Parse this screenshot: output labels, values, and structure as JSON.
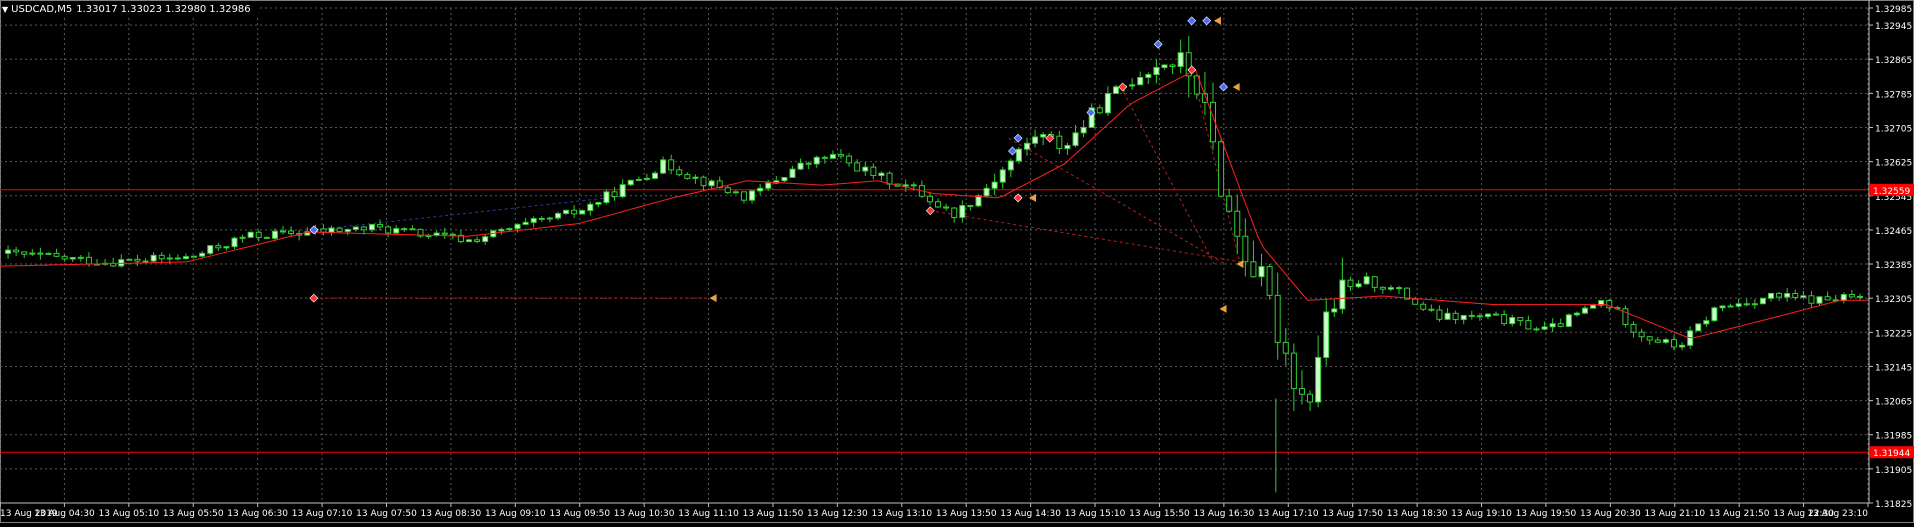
{
  "chart_data": {
    "type": "candlestick",
    "symbol": "USDCAD,M5",
    "header_values": {
      "open": "1.33017",
      "high": "1.33023",
      "low": "1.32980",
      "close": "1.32986"
    },
    "ylim": [
      1.31825,
      1.32985
    ],
    "y_ticks": [
      "1.32985",
      "1.32945",
      "1.32865",
      "1.32785",
      "1.32705",
      "1.32625",
      "1.32545",
      "1.32465",
      "1.32385",
      "1.32305",
      "1.32225",
      "1.32145",
      "1.32065",
      "1.31985",
      "1.31905",
      "1.31825"
    ],
    "x_ticks": [
      "13 Aug 2019",
      "13 Aug 04:30",
      "13 Aug 05:10",
      "13 Aug 05:50",
      "13 Aug 06:30",
      "13 Aug 07:10",
      "13 Aug 07:50",
      "13 Aug 08:30",
      "13 Aug 09:10",
      "13 Aug 09:50",
      "13 Aug 10:30",
      "13 Aug 11:10",
      "13 Aug 11:50",
      "13 Aug 12:30",
      "13 Aug 13:10",
      "13 Aug 13:50",
      "13 Aug 14:30",
      "13 Aug 15:10",
      "13 Aug 15:50",
      "13 Aug 16:30",
      "13 Aug 17:10",
      "13 Aug 17:50",
      "13 Aug 18:30",
      "13 Aug 19:10",
      "13 Aug 19:50",
      "13 Aug 20:30",
      "13 Aug 21:10",
      "13 Aug 21:50",
      "13 Aug 22:30",
      "13 Aug 23:10"
    ],
    "horizontal_lines": [
      {
        "price": 1.32559,
        "label": "1.32559",
        "color": "#ff0000"
      },
      {
        "price": 1.31944,
        "label": "1.31944",
        "color": "#ff0000"
      }
    ],
    "price_path": [
      [
        0,
        1.3241
      ],
      [
        0.055,
        1.3239
      ],
      [
        0.1,
        1.324
      ],
      [
        0.13,
        1.3245
      ],
      [
        0.165,
        1.3246
      ],
      [
        0.2,
        1.3247
      ],
      [
        0.25,
        1.3244
      ],
      [
        0.275,
        1.3247
      ],
      [
        0.31,
        1.3251
      ],
      [
        0.335,
        1.3257
      ],
      [
        0.355,
        1.3262
      ],
      [
        0.375,
        1.3258
      ],
      [
        0.4,
        1.3254
      ],
      [
        0.425,
        1.3261
      ],
      [
        0.445,
        1.3264
      ],
      [
        0.47,
        1.3259
      ],
      [
        0.49,
        1.3256
      ],
      [
        0.51,
        1.325
      ],
      [
        0.525,
        1.3255
      ],
      [
        0.54,
        1.3262
      ],
      [
        0.555,
        1.3269
      ],
      [
        0.57,
        1.3266
      ],
      [
        0.59,
        1.3276
      ],
      [
        0.61,
        1.3283
      ],
      [
        0.625,
        1.3286
      ],
      [
        0.64,
        1.3283
      ],
      [
        0.66,
        1.3248
      ],
      [
        0.675,
        1.3235
      ],
      [
        0.69,
        1.3217
      ],
      [
        0.7,
        1.3205
      ],
      [
        0.712,
        1.3228
      ],
      [
        0.73,
        1.3235
      ],
      [
        0.75,
        1.3232
      ],
      [
        0.77,
        1.3226
      ],
      [
        0.8,
        1.3226
      ],
      [
        0.83,
        1.3223
      ],
      [
        0.86,
        1.323
      ],
      [
        0.88,
        1.3222
      ],
      [
        0.9,
        1.3219
      ],
      [
        0.92,
        1.3228
      ],
      [
        0.95,
        1.3231
      ],
      [
        0.975,
        1.323
      ],
      [
        1,
        1.3231
      ]
    ],
    "ma_path": [
      [
        0,
        1.3238
      ],
      [
        0.1,
        1.3239
      ],
      [
        0.165,
        1.3246
      ],
      [
        0.25,
        1.3245
      ],
      [
        0.31,
        1.3248
      ],
      [
        0.36,
        1.3254
      ],
      [
        0.4,
        1.3258
      ],
      [
        0.44,
        1.3257
      ],
      [
        0.47,
        1.3258
      ],
      [
        0.5,
        1.3255
      ],
      [
        0.535,
        1.3254
      ],
      [
        0.57,
        1.3262
      ],
      [
        0.605,
        1.3276
      ],
      [
        0.64,
        1.3284
      ],
      [
        0.675,
        1.3243
      ],
      [
        0.7,
        1.323
      ],
      [
        0.74,
        1.3231
      ],
      [
        0.8,
        1.3229
      ],
      [
        0.86,
        1.3229
      ],
      [
        0.905,
        1.3221
      ],
      [
        0.95,
        1.3226
      ],
      [
        0.985,
        1.323
      ]
    ],
    "trade_arrows": [
      {
        "x1": 0.168,
        "p1": 1.32465,
        "x2": 0.336,
        "p2": 1.32545,
        "color": "#2a3a9a"
      },
      {
        "x1": 0.168,
        "p1": 1.32305,
        "x2": 0.382,
        "p2": 1.32305,
        "color": "#b02020"
      },
      {
        "x1": 0.498,
        "p1": 1.3251,
        "x2": 0.664,
        "p2": 1.3239,
        "color": "#b02020"
      },
      {
        "x1": 0.54,
        "p1": 1.3268,
        "x2": 0.656,
        "p2": 1.32385,
        "color": "#b02020"
      },
      {
        "x1": 0.6,
        "p1": 1.328,
        "x2": 0.65,
        "p2": 1.32385,
        "color": "#b02020"
      },
      {
        "x1": 0.638,
        "p1": 1.3284,
        "x2": 0.664,
        "p2": 1.32385,
        "color": "#b02020"
      }
    ],
    "markers": [
      {
        "x": 0.168,
        "p": 1.32465,
        "color": "#4a6cff"
      },
      {
        "x": 0.168,
        "p": 1.32305,
        "color": "#ff3030"
      },
      {
        "x": 0.382,
        "p": 1.32305,
        "color": "#e8a040",
        "shape": "arrow"
      },
      {
        "x": 0.498,
        "p": 1.3251,
        "color": "#ff3030"
      },
      {
        "x": 0.542,
        "p": 1.3265,
        "color": "#4a6cff"
      },
      {
        "x": 0.545,
        "p": 1.3268,
        "color": "#4a6cff"
      },
      {
        "x": 0.545,
        "p": 1.3254,
        "color": "#ff3030"
      },
      {
        "x": 0.553,
        "p": 1.3254,
        "color": "#e8a040",
        "shape": "arrow"
      },
      {
        "x": 0.562,
        "p": 1.3268,
        "color": "#ff3030"
      },
      {
        "x": 0.584,
        "p": 1.3274,
        "color": "#4a6cff"
      },
      {
        "x": 0.601,
        "p": 1.328,
        "color": "#ff3030"
      },
      {
        "x": 0.62,
        "p": 1.329,
        "color": "#4a6cff"
      },
      {
        "x": 0.638,
        "p": 1.32955,
        "color": "#4a6cff"
      },
      {
        "x": 0.646,
        "p": 1.32955,
        "color": "#4a6cff"
      },
      {
        "x": 0.652,
        "p": 1.32955,
        "color": "#e8a040",
        "shape": "arrow"
      },
      {
        "x": 0.638,
        "p": 1.3284,
        "color": "#ff3030"
      },
      {
        "x": 0.655,
        "p": 1.328,
        "color": "#4a6cff"
      },
      {
        "x": 0.662,
        "p": 1.328,
        "color": "#e8a040",
        "shape": "arrow"
      },
      {
        "x": 0.655,
        "p": 1.3228,
        "color": "#e8a040",
        "shape": "arrow"
      },
      {
        "x": 0.664,
        "p": 1.32385,
        "color": "#e8a040",
        "shape": "arrow"
      }
    ],
    "colors": {
      "background": "#000000",
      "grid": "#5a5a5a",
      "axis_text": "#ffffff",
      "bull_body": "#ccffcc",
      "bear_body": "#000000",
      "candle_outline": "#32cd32",
      "ma_line": "#ff2020",
      "hline_label_bg": "#ff0000"
    }
  }
}
